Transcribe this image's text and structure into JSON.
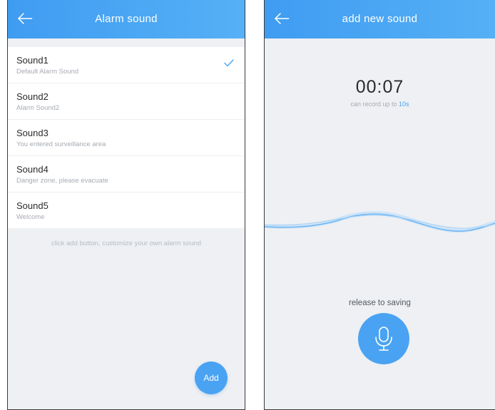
{
  "left_screen": {
    "header": {
      "title": "Alarm sound"
    },
    "sounds": [
      {
        "name": "Sound1",
        "description": "Default Alarm Sound",
        "selected": true
      },
      {
        "name": "Sound2",
        "description": "Alarm Sound2",
        "selected": false
      },
      {
        "name": "Sound3",
        "description": "You entered surveillance area",
        "selected": false
      },
      {
        "name": "Sound4",
        "description": "Danger zone, please evacuate",
        "selected": false
      },
      {
        "name": "Sound5",
        "description": "Welcome",
        "selected": false
      }
    ],
    "hint": "click add button, customize your own alarm sound",
    "add_label": "Add"
  },
  "right_screen": {
    "header": {
      "title": "add new sound"
    },
    "timer": "00:07",
    "record_limit_prefix": "can record up to ",
    "record_limit_value": "10s",
    "release_label": "release to saving"
  },
  "icons": {
    "back": "arrow-left-icon",
    "check": "checkmark-icon",
    "mic": "microphone-icon"
  },
  "colors": {
    "accent": "#4aa3f2",
    "header_start": "#3f9cf1",
    "header_end": "#56b0f6",
    "background": "#eef0f3"
  }
}
